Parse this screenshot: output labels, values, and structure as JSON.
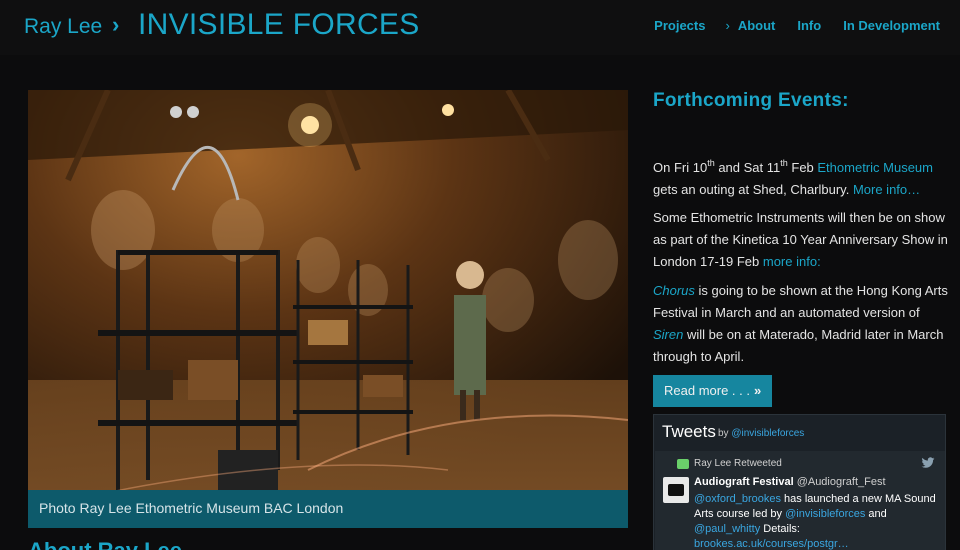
{
  "header": {
    "site_name": "Ray Lee",
    "separator": "›",
    "page_title": "INVISIBLE FORCES",
    "nav": {
      "projects": "Projects",
      "chevron": "›",
      "about": "About",
      "info": "Info",
      "in_development": "In Development"
    }
  },
  "main": {
    "photo_caption": "Photo Ray Lee Ethometric Museum BAC London",
    "about_heading": "About Ray Lee"
  },
  "sidebar": {
    "events_heading": "Forthcoming Events:",
    "p1": {
      "t1": "On Fri 10",
      "sup1": "th",
      "t2": " and Sat 11",
      "sup2": "th",
      "t3": " Feb ",
      "link1": "Ethometric Museum",
      "t4": " gets an outing at Shed, Charlbury. ",
      "link2": "More info…"
    },
    "p2": {
      "t1": "Some Ethometric Instruments will then be on show as part of the Kinetica 10 Year Anniversary Show in London 17-19 Feb  ",
      "link1": "more info:"
    },
    "p3": {
      "link1": "Chorus",
      "t1": " is going to be shown at the Hong Kong Arts Festival in March and an automated version of ",
      "link2": "Siren",
      "t2": " will be on at Materado, Madrid later in March through to April."
    },
    "read_more": "Read more . . .",
    "read_more_icon": "»",
    "tweets": {
      "title": "Tweets",
      "by": "by",
      "by_handle": "@invisibleforces",
      "retweet_label": "Ray Lee Retweeted",
      "author_name": "Audiograft Festival",
      "author_handle": "@Audiograft_Fest",
      "mention1": "@oxford_brookes",
      "text1": " has launched a new MA Sound Arts course led by ",
      "mention2": "@invisibleforces",
      "text2": " and ",
      "mention3": "@paul_whitty",
      "text3": " Details: ",
      "link": "brookes.ac.uk/courses/postgr…"
    }
  },
  "colors": {
    "accent": "#1ba6c8",
    "background": "#0c0c0d",
    "caption_bar": "#0d5a6b",
    "button": "#16869f",
    "tweet_panel": "#1b2127"
  },
  "icons": [
    "chevron-right-icon",
    "double-chevron-right-icon",
    "retweet-icon",
    "twitter-bird-icon"
  ]
}
